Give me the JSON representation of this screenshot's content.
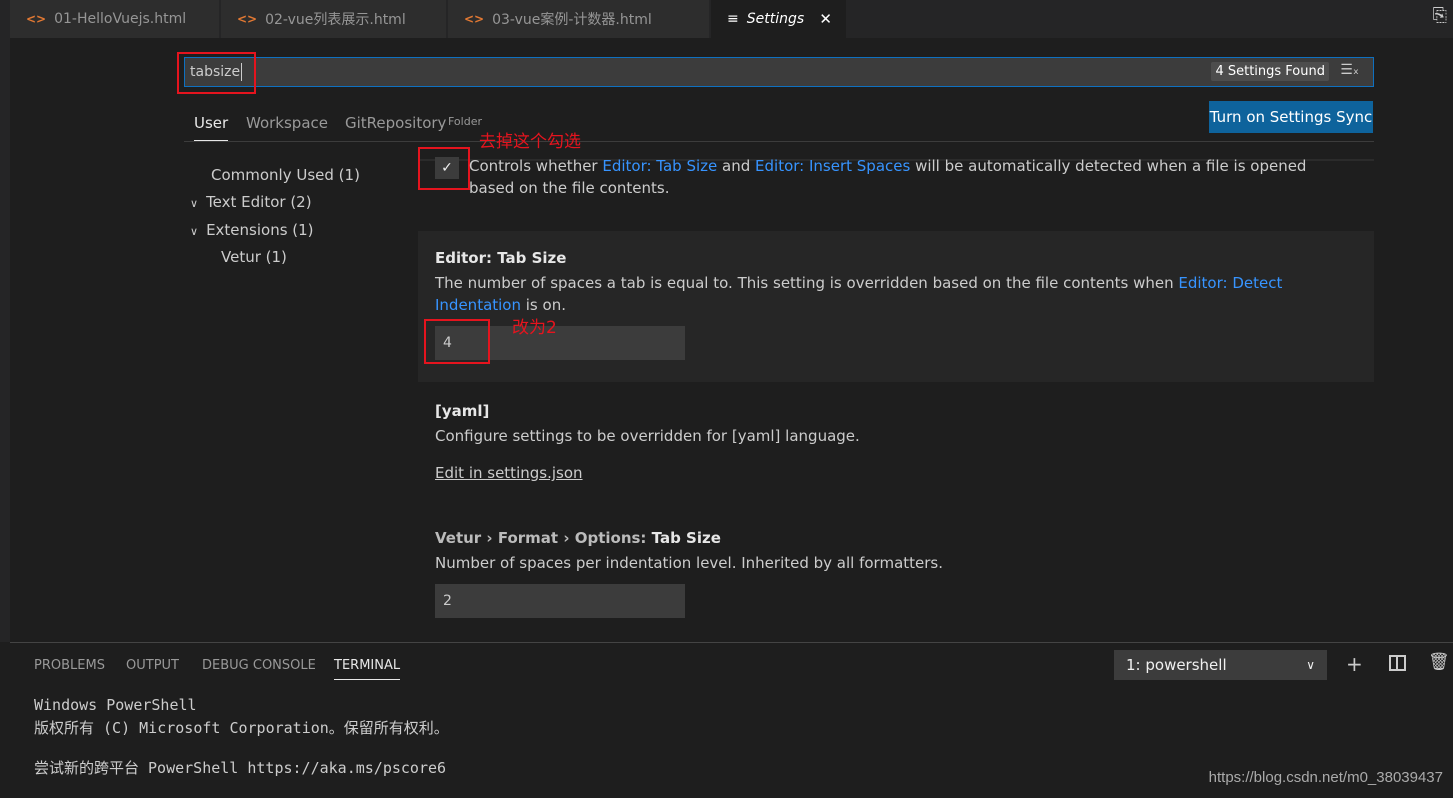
{
  "tabs": [
    {
      "label": "01-HelloVuejs.html",
      "icon": "html-icon"
    },
    {
      "label": "02-vue列表展示.html",
      "icon": "html-icon"
    },
    {
      "label": "03-vue案例-计数器.html",
      "icon": "html-icon"
    },
    {
      "label": "Settings",
      "icon": "settings-list-icon",
      "active": true
    }
  ],
  "search": {
    "value": "tabsize",
    "result": "4 Settings Found"
  },
  "scopes": {
    "user": "User",
    "workspace": "Workspace",
    "folder": "GitRepository",
    "folder_tag": "Folder"
  },
  "sync_button": "Turn on Settings Sync",
  "toc": [
    {
      "label": "Commonly Used (1)"
    },
    {
      "label": "Text Editor (2)"
    },
    {
      "label": "Extensions (1)"
    },
    {
      "label": "Vetur (1)"
    }
  ],
  "settings": {
    "detect": {
      "pre": "Controls whether ",
      "link1": "Editor: Tab Size",
      "mid": " and ",
      "link2": "Editor: Insert Spaces",
      "post": " will be automatically detected when a file is opened based on the file contents.",
      "checked": true
    },
    "tabsize": {
      "category": "Editor: ",
      "name": "Tab Size",
      "desc": "The number of spaces a tab is equal to. This setting is overridden based on the file contents when ",
      "link": "Editor: Detect Indentation",
      "desc_end": " is on.",
      "value": "4"
    },
    "yaml": {
      "name": "[yaml]",
      "desc": "Configure settings to be overridden for [yaml] language.",
      "link": "Edit in settings.json"
    },
    "vetur": {
      "category": "Vetur › Format › Options: ",
      "name": "Tab Size",
      "desc": "Number of spaces per indentation level. Inherited by all formatters.",
      "value": "2"
    }
  },
  "annotations": {
    "uncheck": "去掉这个勾选",
    "change": "改为2"
  },
  "panel": {
    "tabs": [
      "PROBLEMS",
      "OUTPUT",
      "DEBUG CONSOLE",
      "TERMINAL"
    ],
    "terminal_select": "1: powershell",
    "lines": [
      "Windows PowerShell",
      "版权所有 (C) Microsoft Corporation。保留所有权利。",
      "",
      "尝试新的跨平台 PowerShell https://aka.ms/pscore6"
    ]
  },
  "watermark": "https://blog.csdn.net/m0_38039437",
  "colors": {
    "accent": "#0e639c",
    "link": "#3794ff",
    "annotation": "#e5141e"
  }
}
